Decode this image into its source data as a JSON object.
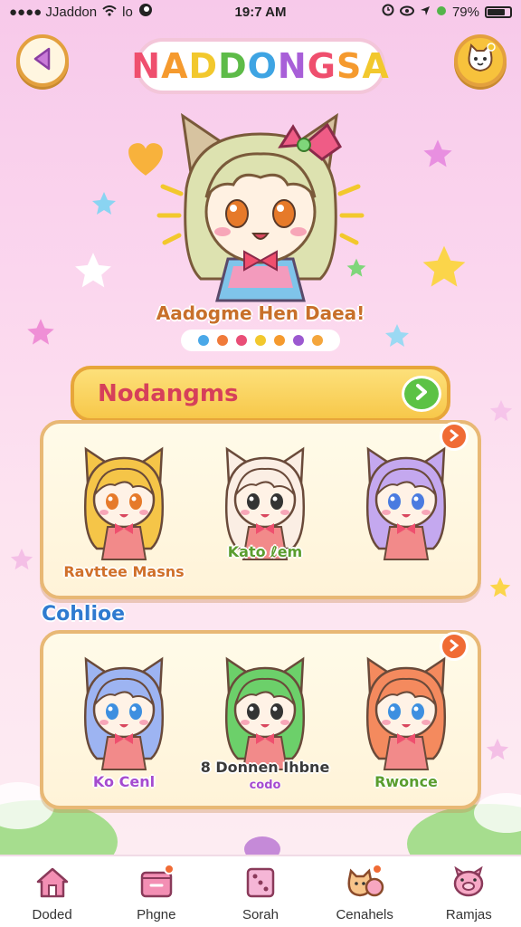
{
  "status_bar": {
    "carrier": "●●●● JJaddon",
    "signal": "lo",
    "time": "19:7 AM",
    "battery": "79%",
    "battery_level": 0.79
  },
  "header": {
    "title": "NADDONGSA",
    "back_icon": "triangle-back-icon",
    "profile_icon": "cat-face-icon"
  },
  "hero": {
    "caption": "Aadogme Hen Daea!",
    "dot_colors": [
      "#4aa8e8",
      "#f07a3a",
      "#e94e77",
      "#f2c82d",
      "#f59a2e",
      "#9b59d0",
      "#f4a63c"
    ]
  },
  "section_bar": {
    "label": "Nodangms"
  },
  "panel_1": {
    "characters": [
      {
        "label": "Ravttee Masns",
        "label_color": "#d0702a",
        "hair": "#f5c548",
        "eye": "#e67a2a"
      },
      {
        "label": "Kato ℓem",
        "label_color": "#5a9d2e",
        "hair": "#fbeee4",
        "eye": "#333333"
      },
      {
        "label": "",
        "label_color": "#d0702a",
        "hair": "#c4a8ef",
        "eye": "#4a7be0"
      }
    ]
  },
  "section_label": "Cohlioe",
  "panel_2": {
    "characters": [
      {
        "label": "Ko Cenl",
        "label_color": "#a54bcf",
        "hair": "#9db4f2",
        "eye": "#3d8fe0"
      },
      {
        "label": "8 Donnen Ihbne",
        "sub": "codo",
        "label_color": "#3a3a3a",
        "hair": "#6cd06a",
        "eye": "#333333"
      },
      {
        "label": "Rwonce",
        "label_color": "#5a9d2e",
        "hair": "#f48a5e",
        "eye": "#3d8fe0"
      }
    ]
  },
  "bottom_nav": [
    {
      "label": "Doded",
      "icon": "house-icon",
      "badge": false
    },
    {
      "label": "Phgne",
      "icon": "mail-box-icon",
      "badge": true
    },
    {
      "label": "Sorah",
      "icon": "dice-icon",
      "badge": false
    },
    {
      "label": "Cenahels",
      "icon": "cat-group-icon",
      "badge": true
    },
    {
      "label": "Ramjas",
      "icon": "pig-face-icon",
      "badge": false
    }
  ]
}
